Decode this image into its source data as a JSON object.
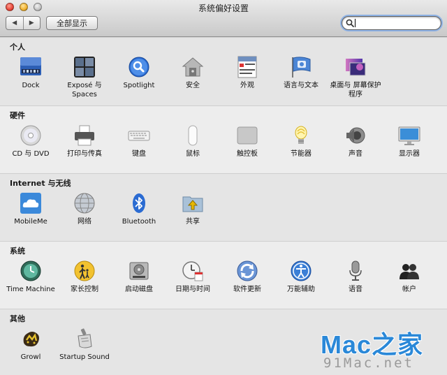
{
  "window": {
    "title": "系统偏好设置"
  },
  "toolbar": {
    "back": "◀",
    "forward": "▶",
    "show_all": "全部显示",
    "search_value": ""
  },
  "sections": [
    {
      "title": "个人",
      "items": [
        {
          "label": "Dock",
          "icon": "dock-icon"
        },
        {
          "label": "Exposé 与 Spaces",
          "icon": "expose-spaces-icon"
        },
        {
          "label": "Spotlight",
          "icon": "spotlight-icon"
        },
        {
          "label": "安全",
          "icon": "security-house-icon"
        },
        {
          "label": "外观",
          "icon": "appearance-icon"
        },
        {
          "label": "语言与文本",
          "icon": "language-flag-icon"
        },
        {
          "label": "桌面与 屏幕保护程序",
          "icon": "desktop-screensaver-icon"
        }
      ]
    },
    {
      "title": "硬件",
      "items": [
        {
          "label": "CD 与 DVD",
          "icon": "cd-dvd-icon"
        },
        {
          "label": "打印与传真",
          "icon": "printer-icon"
        },
        {
          "label": "键盘",
          "icon": "keyboard-icon"
        },
        {
          "label": "鼠标",
          "icon": "mouse-icon"
        },
        {
          "label": "触控板",
          "icon": "trackpad-icon"
        },
        {
          "label": "节能器",
          "icon": "energy-bulb-icon"
        },
        {
          "label": "声音",
          "icon": "speaker-icon"
        },
        {
          "label": "显示器",
          "icon": "display-icon"
        }
      ]
    },
    {
      "title": "Internet 与无线",
      "items": [
        {
          "label": "MobileMe",
          "icon": "mobileme-cloud-icon"
        },
        {
          "label": "网络",
          "icon": "network-globe-icon"
        },
        {
          "label": "Bluetooth",
          "icon": "bluetooth-icon"
        },
        {
          "label": "共享",
          "icon": "sharing-folder-icon"
        }
      ]
    },
    {
      "title": "系统",
      "items": [
        {
          "label": "Time Machine",
          "icon": "time-machine-icon"
        },
        {
          "label": "家长控制",
          "icon": "parental-controls-icon"
        },
        {
          "label": "启动磁盘",
          "icon": "startup-disk-icon"
        },
        {
          "label": "日期与时间",
          "icon": "date-time-clock-icon"
        },
        {
          "label": "软件更新",
          "icon": "software-update-icon"
        },
        {
          "label": "万能辅助",
          "icon": "accessibility-icon"
        },
        {
          "label": "语音",
          "icon": "microphone-icon"
        },
        {
          "label": "帐户",
          "icon": "accounts-icon"
        }
      ]
    },
    {
      "title": "其他",
      "items": [
        {
          "label": "Growl",
          "icon": "growl-icon"
        },
        {
          "label": "Startup Sound",
          "icon": "startup-sound-icon"
        }
      ]
    }
  ],
  "watermark": {
    "logo": "Mac之家",
    "url": "91Mac.net"
  },
  "colors": {
    "search_focus": "#8fb3e6",
    "watermark_logo": "#2a88d8",
    "watermark_url": "#9a9a9a"
  }
}
